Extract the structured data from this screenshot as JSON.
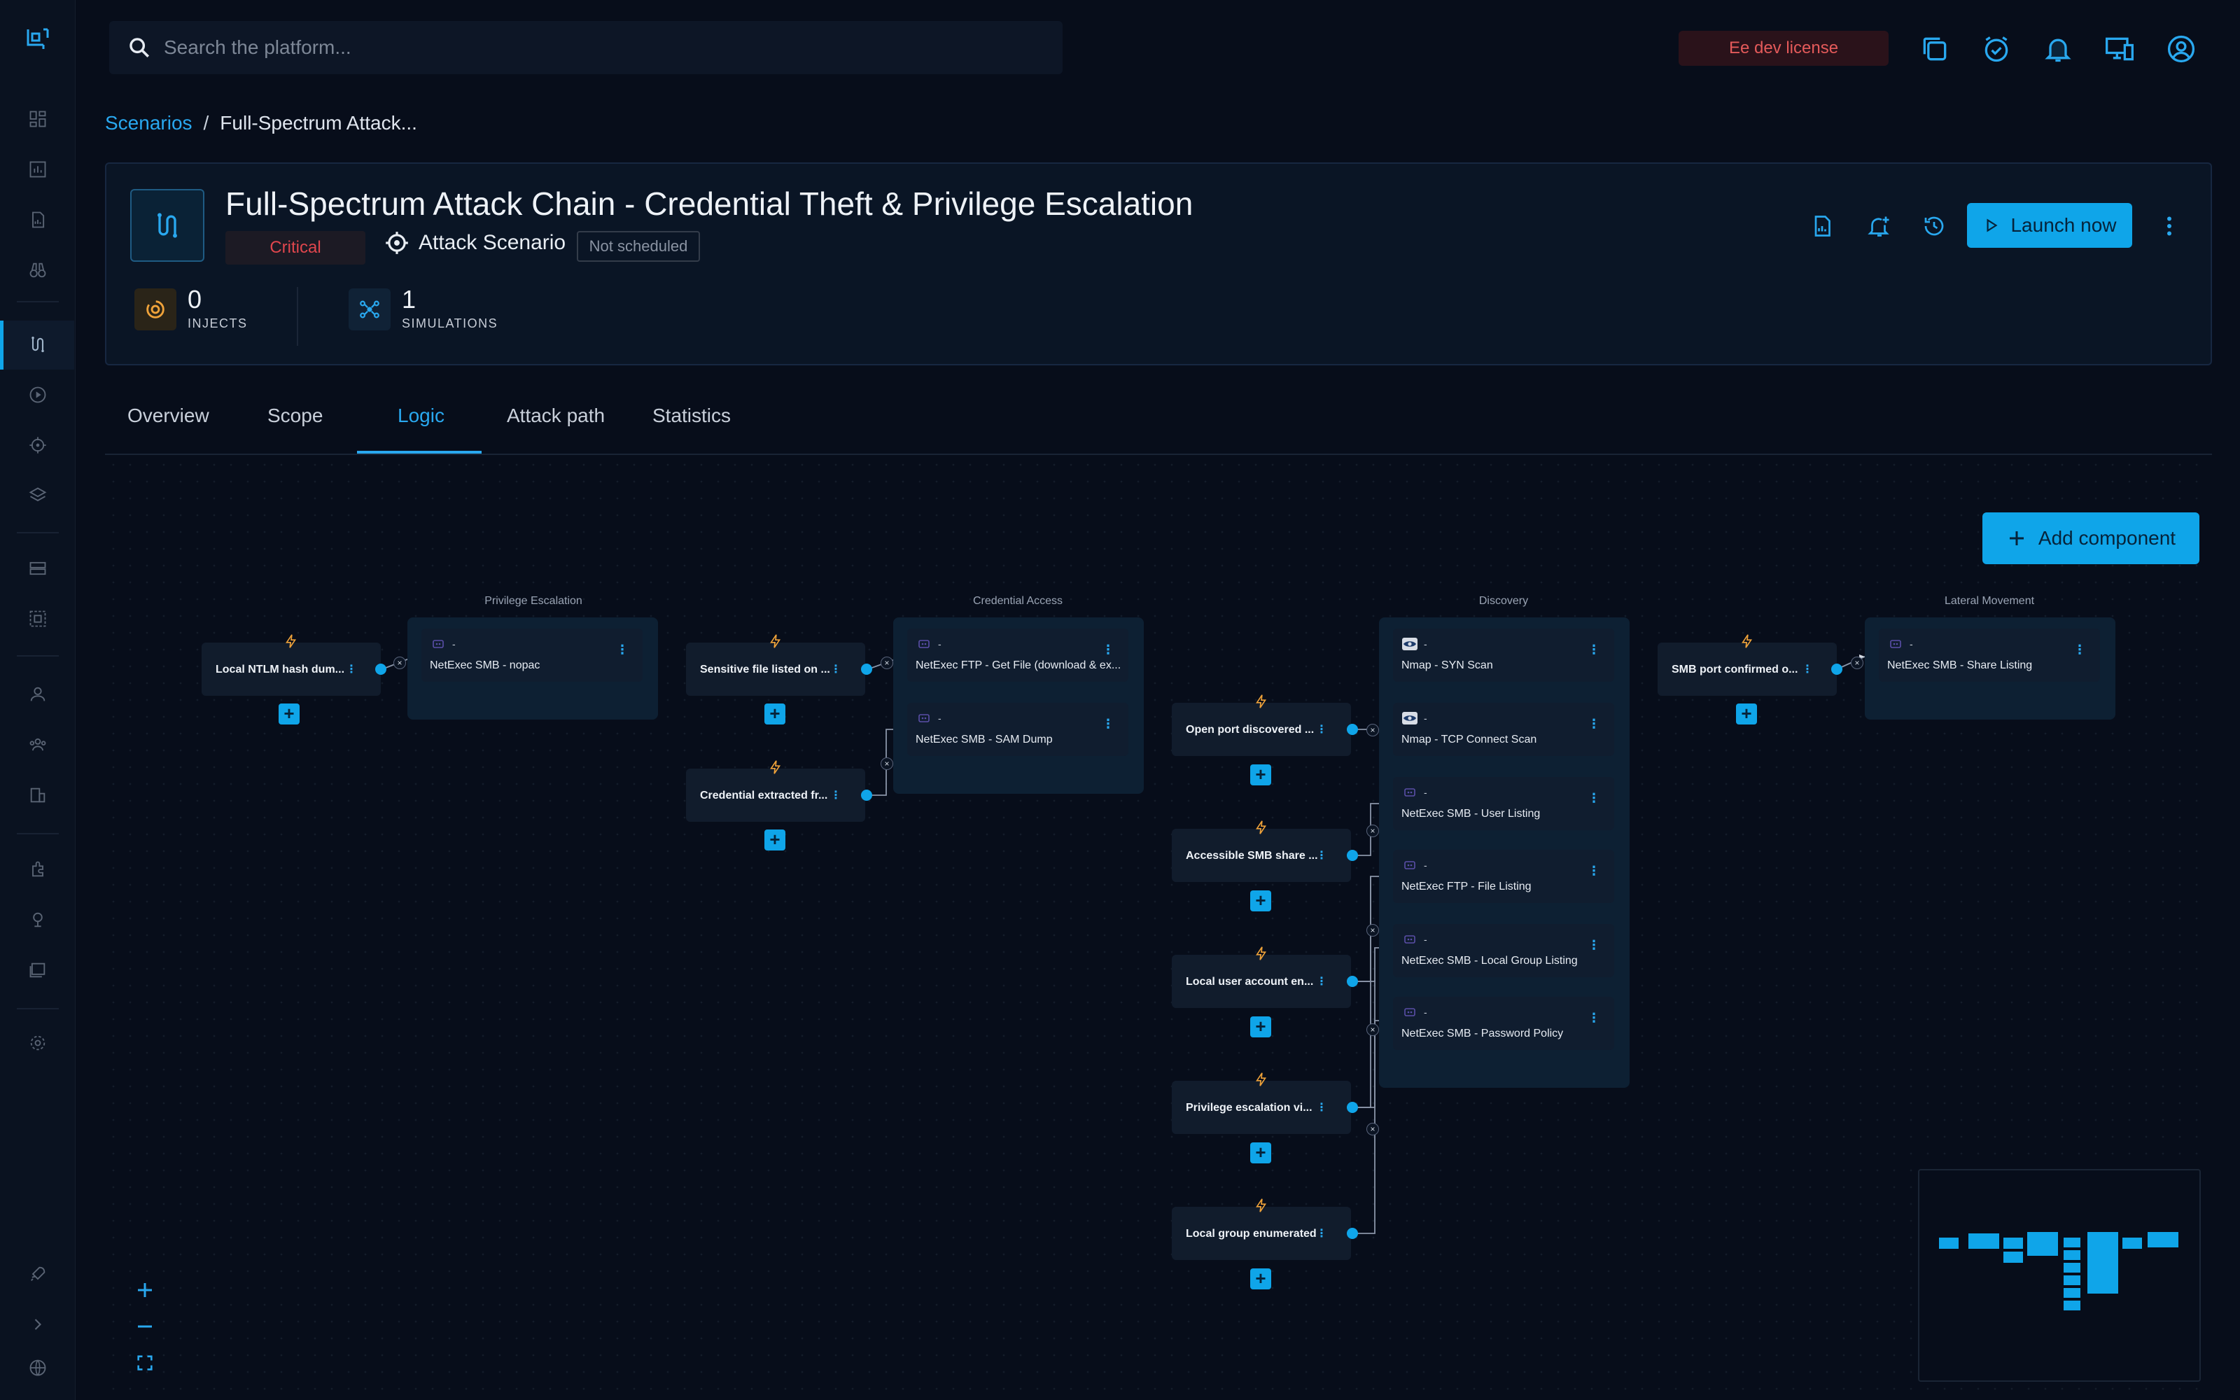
{
  "search": {
    "placeholder": "Search the platform..."
  },
  "license": "Ee dev license",
  "breadcrumb": {
    "root": "Scenarios",
    "sep": "/",
    "current": "Full-Spectrum Attack..."
  },
  "scenario": {
    "title": "Full-Spectrum Attack Chain - Credential Theft & Privilege Escalation",
    "severity": "Critical",
    "type": "Attack Scenario",
    "schedule": "Not scheduled",
    "injects": {
      "value": "0",
      "label": "INJECTS"
    },
    "simulations": {
      "value": "1",
      "label": "SIMULATIONS"
    },
    "launch_label": "Launch now"
  },
  "tabs": [
    "Overview",
    "Scope",
    "Logic",
    "Attack path",
    "Statistics"
  ],
  "active_tab": "Logic",
  "canvas": {
    "add_component": "Add component",
    "groups": [
      "Privilege Escalation",
      "Credential Access",
      "Discovery",
      "Lateral Movement"
    ],
    "conditions": {
      "pe": "Local NTLM hash dum...",
      "ca1": "Sensitive file listed on ...",
      "ca2": "Credential extracted fr...",
      "d1": "Open port discovered ...",
      "d2": "Accessible SMB share ...",
      "d3": "Local user account en...",
      "d4": "Privilege escalation vi...",
      "d5": "Local group enumerated",
      "lm": "SMB port confirmed o..."
    },
    "injects": {
      "pe1": "NetExec SMB - nopac",
      "ca1": "NetExec FTP - Get File (download & ex...",
      "ca2": "NetExec SMB - SAM Dump",
      "d1": "Nmap - SYN Scan",
      "d2": "Nmap - TCP Connect Scan",
      "d3": "NetExec SMB - User Listing",
      "d4": "NetExec FTP - File Listing",
      "d5": "NetExec SMB - Local Group Listing",
      "d6": "NetExec SMB - Password Policy",
      "lm1": "NetExec SMB - Share Listing"
    },
    "dash": "-"
  },
  "colors": {
    "accent": "#0fa5e9",
    "critical": "#e0464d",
    "background": "#070d1a",
    "inject_icon": "#f0a33a"
  },
  "icons": [
    "logo-icon",
    "search-icon",
    "documents-icon",
    "check-alarm-icon",
    "bell-icon",
    "monitor-icon",
    "account-icon",
    "report-icon",
    "notification-add-icon",
    "history-icon",
    "play-icon",
    "more-vert-icon",
    "bolt-icon",
    "robot-icon",
    "eye-icon",
    "zoom-in-icon",
    "zoom-out-icon",
    "fit-view-icon"
  ]
}
